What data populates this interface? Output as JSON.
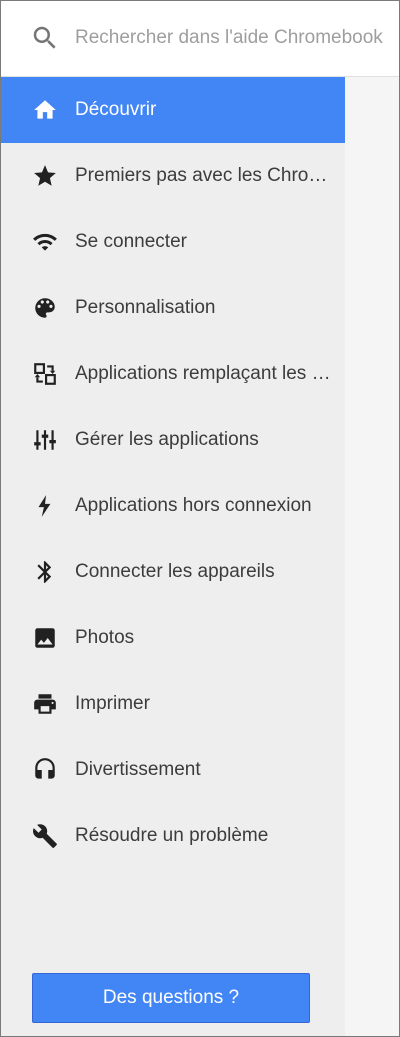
{
  "search": {
    "placeholder": "Rechercher dans l'aide Chromebook",
    "icon": "search-icon"
  },
  "sidebar": {
    "items": [
      {
        "label": "Découvrir",
        "icon": "home-icon",
        "active": true
      },
      {
        "label": "Premiers pas avec les Chromebooks",
        "icon": "star-icon",
        "active": false
      },
      {
        "label": "Se connecter",
        "icon": "wifi-icon",
        "active": false
      },
      {
        "label": "Personnalisation",
        "icon": "palette-icon",
        "active": false
      },
      {
        "label": "Applications remplaçant les logiciels",
        "icon": "swap-apps-icon",
        "active": false
      },
      {
        "label": "Gérer les applications",
        "icon": "sliders-icon",
        "active": false
      },
      {
        "label": "Applications hors connexion",
        "icon": "flash-icon",
        "active": false
      },
      {
        "label": "Connecter les appareils",
        "icon": "bluetooth-icon",
        "active": false
      },
      {
        "label": "Photos",
        "icon": "photo-icon",
        "active": false
      },
      {
        "label": "Imprimer",
        "icon": "printer-icon",
        "active": false
      },
      {
        "label": "Divertissement",
        "icon": "headphones-icon",
        "active": false
      },
      {
        "label": "Résoudre un problème",
        "icon": "wrench-icon",
        "active": false
      }
    ]
  },
  "footer": {
    "questions_label": "Des questions ?"
  },
  "colors": {
    "accent": "#4285f4",
    "sidebar_bg": "#eeeeee",
    "text": "#3c3c3c"
  }
}
